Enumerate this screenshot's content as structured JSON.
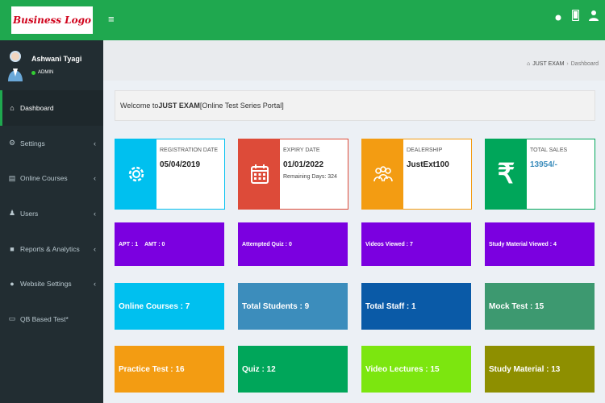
{
  "header": {
    "logo_text": "Business Logo",
    "menu_icon": "hamburger-icon",
    "icons": [
      "notifications-icon",
      "device-icon",
      "user-icon"
    ]
  },
  "user": {
    "name": "Ashwani Tyagi",
    "role": "ADMIN",
    "status_color": "#33cc33"
  },
  "sidebar": {
    "items": [
      {
        "label": "Dashboard",
        "icon": "home-icon"
      },
      {
        "label": "Settings",
        "icon": "wrench-icon"
      },
      {
        "label": "Online Courses",
        "icon": "book-icon"
      },
      {
        "label": "Users",
        "icon": "users-icon"
      },
      {
        "label": "Reports & Analytics",
        "icon": "chart-icon"
      },
      {
        "label": "Website Settings",
        "icon": "globe-icon"
      },
      {
        "label": "QB Based Test*",
        "icon": "laptop-icon"
      }
    ]
  },
  "breadcrumb": {
    "home": "JUST EXAM",
    "separator": "›",
    "current": "Dashboard"
  },
  "welcome": {
    "prefix": "Welcome to ",
    "brand": "JUST EXAM",
    "suffix": " [Online Test Series Portal]"
  },
  "info_boxes": [
    {
      "label": "REGISTRATION DATE",
      "value": "05/04/2019",
      "sub": "",
      "icon": "gear-icon",
      "color": "#00c0ef"
    },
    {
      "label": "EXPIRY DATE",
      "value": "01/01/2022",
      "sub": "Remaining Days: 324",
      "icon": "calendar-icon",
      "color": "#dd4b39"
    },
    {
      "label": "DEALERSHIP",
      "value": "JustExt100",
      "sub": "",
      "icon": "people-icon",
      "color": "#f39c12"
    },
    {
      "label": "TOTAL SALES",
      "value": "13954/-",
      "sub": "",
      "icon": "rupee-icon",
      "color": "#00a65a"
    }
  ],
  "row_purple": {
    "apt": "APT : 1",
    "amt": "AMT : 0",
    "attempted_quiz": "Attempted Quiz : 0",
    "videos_viewed": "Videos Viewed : 7",
    "study_material_viewed": "Study Material Viewed : 4"
  },
  "row_blue": {
    "online_courses": "Online Courses : 7",
    "total_students": "Total Students : 9",
    "total_staff": "Total Staff : 1",
    "mock_test": "Mock Test : 15"
  },
  "row_bottom": {
    "practice_test": "Practice Test : 16",
    "quiz": "Quiz : 12",
    "video_lectures": "Video Lectures : 15",
    "study_material": "Study Material : 13"
  },
  "colors": {
    "header_green": "#1fa84f",
    "sidebar_dark": "#222d32",
    "purple": "#7b00e0",
    "cyan": "#00c0ef",
    "steel_blue": "#3c8dbc",
    "navy_blue": "#0a5aa7",
    "teal_green": "#3d9970",
    "orange": "#f39c12",
    "green": "#00a65a",
    "lime": "#7ce60f",
    "olive": "#8e8f00"
  }
}
